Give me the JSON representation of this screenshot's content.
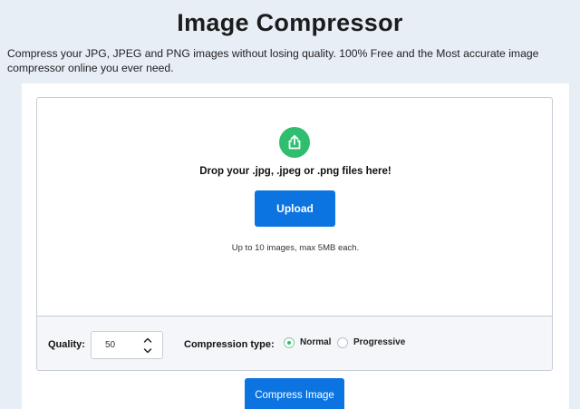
{
  "header": {
    "title": "Image Compressor",
    "subtitle": "Compress your JPG, JPEG and PNG images without losing quality. 100% Free and the Most accurate image compressor online you ever need."
  },
  "dropzone": {
    "icon": "upload-share-icon",
    "drop_text": "Drop your .jpg, .jpeg or .png files here!",
    "upload_label": "Upload",
    "limit_text": "Up to 10 images, max 5MB each."
  },
  "options": {
    "quality_label": "Quality:",
    "quality_value": "50",
    "compression_label": "Compression type:",
    "types": [
      {
        "label": "Normal",
        "selected": true
      },
      {
        "label": "Progressive",
        "selected": false
      }
    ]
  },
  "actions": {
    "compress_label": "Compress Image"
  },
  "colors": {
    "background": "#e8eef6",
    "primary_button": "#0b74e0",
    "accent_green": "#2fbd6f"
  }
}
